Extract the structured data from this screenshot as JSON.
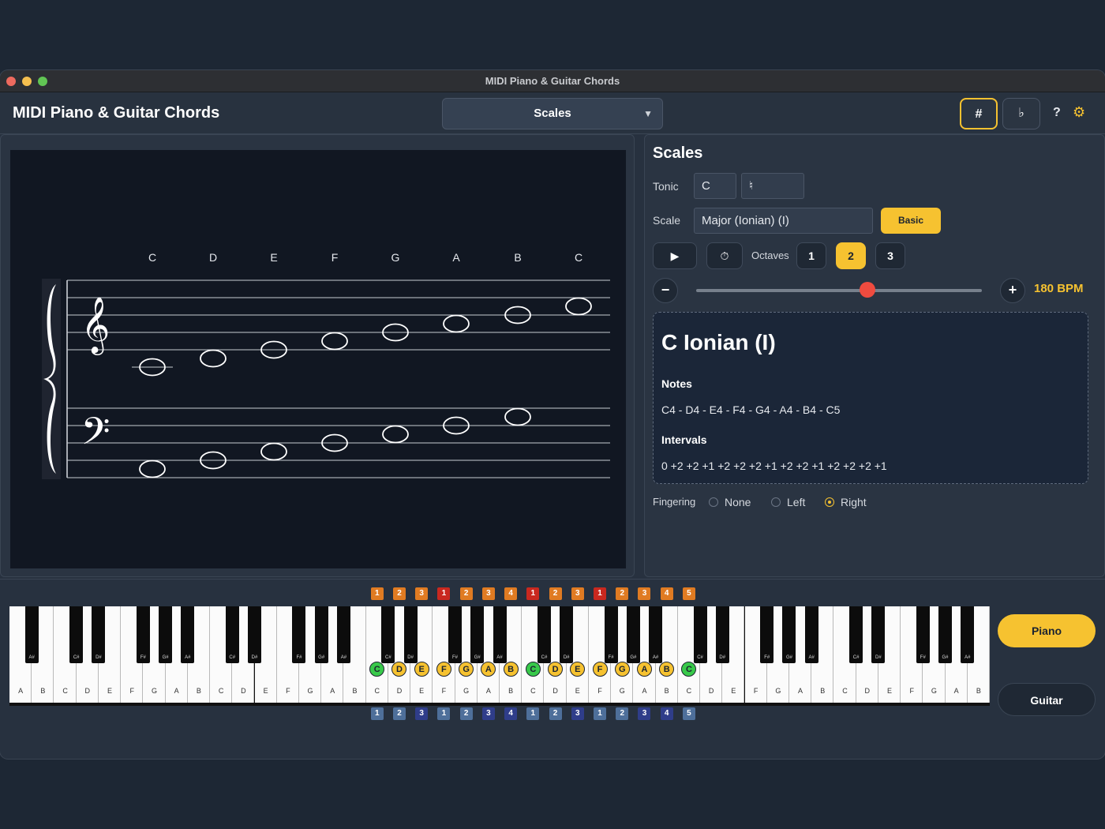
{
  "window": {
    "title": "MIDI Piano & Guitar Chords"
  },
  "toolbar": {
    "app_title": "MIDI Piano & Guitar Chords",
    "mode": "Scales",
    "sharp_label": "#",
    "flat_label": "♭",
    "help_label": "?",
    "settings_icon": "gear-icon"
  },
  "staff": {
    "note_letters": [
      "C",
      "D",
      "E",
      "F",
      "G",
      "A",
      "B",
      "C"
    ],
    "treble_clef": "𝄞",
    "bass_clef": "𝄢"
  },
  "scales_panel": {
    "title": "Scales",
    "tonic_label": "Tonic",
    "tonic_value": "C",
    "accidental_value": "♮",
    "scale_label": "Scale",
    "scale_value": "Major (Ionian) (I)",
    "basic_label": "Basic",
    "play_icon": "▶",
    "metronome_icon": "⏱",
    "octaves_label": "Octaves",
    "octave_options": [
      "1",
      "2",
      "3"
    ],
    "selected_octave": "2",
    "minus_label": "−",
    "plus_label": "+",
    "tempo_fraction": 0.6,
    "bpm_label": "180 BPM",
    "info": {
      "name": "C Ionian (I)",
      "notes_heading": "Notes",
      "notes": "C4 - D4 - E4 - F4 - G4 - A4 - B4 - C5",
      "intervals_heading": "Intervals",
      "intervals": "0 +2 +2 +1 +2 +2 +2 +1 +2 +2 +1 +2 +2 +2 +1"
    },
    "fingering_label": "Fingering",
    "fingering_options": [
      "None",
      "Left",
      "Right"
    ],
    "fingering_selected": "Right"
  },
  "keyboard": {
    "white_key_labels": [
      "A",
      "B",
      "C",
      "D",
      "E",
      "F",
      "G",
      "A",
      "B",
      "C",
      "D",
      "E",
      "F",
      "G",
      "A",
      "B",
      "C",
      "D",
      "E",
      "F",
      "G",
      "A",
      "B",
      "C",
      "D",
      "E",
      "F",
      "G",
      "A",
      "B",
      "C",
      "D",
      "E",
      "F",
      "G",
      "A",
      "B",
      "C",
      "D",
      "E",
      "F",
      "G",
      "A",
      "B"
    ],
    "black_key_labels": [
      "A#",
      "C#",
      "D#",
      "F#",
      "G#",
      "A#",
      "C#",
      "D#",
      "F#",
      "G#",
      "A#",
      "C#",
      "D#",
      "F#",
      "G#",
      "A#",
      "C#",
      "D#",
      "F#",
      "G#",
      "A#",
      "C#",
      "D#",
      "F#",
      "G#",
      "A#",
      "C#",
      "D#",
      "F#",
      "G#",
      "A#"
    ],
    "highlighted_notes": [
      "C",
      "D",
      "E",
      "F",
      "G",
      "A",
      "B",
      "C",
      "D",
      "E",
      "F",
      "G",
      "A",
      "B",
      "C"
    ],
    "left_hand_fingering": [
      "1",
      "2",
      "3",
      "1",
      "2",
      "3",
      "4",
      "1",
      "2",
      "3",
      "1",
      "2",
      "3",
      "4",
      "5"
    ],
    "right_hand_fingering": [
      "1",
      "2",
      "3",
      "1",
      "2",
      "3",
      "4",
      "1",
      "2",
      "3",
      "1",
      "2",
      "3",
      "4",
      "5"
    ],
    "colors": {
      "tonic": "#38c94a",
      "scale_note": "#f6c230",
      "accent": "#f6c230"
    }
  },
  "instrument": {
    "piano_label": "Piano",
    "guitar_label": "Guitar",
    "selected": "Piano"
  }
}
